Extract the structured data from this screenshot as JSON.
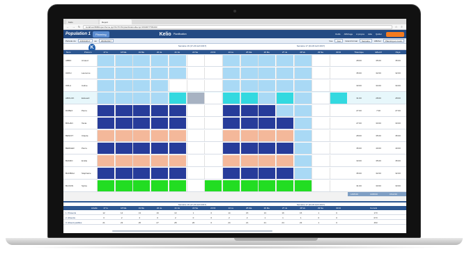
{
  "browser": {
    "tabs": [
      "Kelio",
      "Report"
    ],
    "url": "localhost:8080/open/home.jsp?ACTION=planification&temp=1503677781003"
  },
  "app": {
    "title": "Population 1",
    "planning_button": "Planning",
    "brand": "Kelio",
    "brand_sub": "Planification",
    "menu": [
      "Outils",
      "Affichage",
      "A propos",
      "Aide",
      "Quitter"
    ]
  },
  "toolbar": {
    "label": "Période du",
    "date_from": "23/04/2017",
    "to_label": "au",
    "date_to": "29/04/2017",
    "view_label": "Vue",
    "view_value": "Jour",
    "group_label": "Grand format",
    "group_value": "Semaine",
    "display_label": "Afficher",
    "display_value": "Planning en cours"
  },
  "grid": {
    "week1": "Semaine 16 (17-23 Avril 2017)",
    "week2": "Semaine 17 (24-30 Avril 2017)",
    "col_nom": "Nom",
    "col_prenom": "Prénom",
    "days": [
      "17 lu",
      "18 Ma",
      "19 Me",
      "20 Je",
      "21 Ve",
      "22 Sa",
      "23 Di",
      "24 Lu",
      "25 Ma",
      "26 Me",
      "27 Je",
      "28 Ve",
      "29 Sa",
      "30 Di"
    ],
    "stats_headers": [
      "Théorique",
      "Effectif",
      "Payé"
    ],
    "rows": [
      {
        "nom": "ABBO",
        "prenom": "Arnaud",
        "stats": [
          "28:00",
          "35:00",
          "35:00"
        ]
      },
      {
        "nom": "OZOU",
        "prenom": "Laurence",
        "stats": [
          "35:00",
          "32:00",
          "32:00"
        ]
      },
      {
        "nom": "ORLA",
        "prenom": "Céline",
        "stats": [
          "33:00",
          "34:00",
          "34:00"
        ]
      },
      {
        "nom": "ABOLOK",
        "prenom": "Edouard",
        "stats": [
          "31:00",
          "28:00",
          "28:00"
        ]
      },
      {
        "nom": "DUBEX",
        "prenom": "Pierre",
        "stats": [
          "27:00",
          "7:00",
          "27:00"
        ]
      },
      {
        "nom": "BOHAN",
        "prenom": "Tania",
        "stats": [
          "27:00",
          "33:00",
          "33:00"
        ]
      },
      {
        "nom": "BENOIT",
        "prenom": "Claude",
        "stats": [
          "28:00",
          "35:00",
          "35:00"
        ]
      },
      {
        "nom": "BERGER",
        "prenom": "Pierre",
        "stats": [
          "35:00",
          "40:00",
          "40:00"
        ]
      },
      {
        "nom": "BAKRO",
        "prenom": "Emilie",
        "stats": [
          "33:00",
          "35:00",
          "35:00"
        ]
      },
      {
        "nom": "BLINBALI",
        "prenom": "Stéphanie",
        "stats": [
          "35:00",
          "32:00",
          "32:00"
        ]
      },
      {
        "nom": "BLOUIN",
        "prenom": "Sylvie",
        "stats": [
          "31:00",
          "33:00",
          "33:00"
        ]
      }
    ],
    "totals": [
      "1495:00",
      "1368:00",
      "1512:00"
    ]
  },
  "bottom": {
    "week1": "Semaine 16 (17-23 Avril 2017)",
    "week2": "Semaine 17 (24-30 Avril 2017)",
    "header_label": "Libellé",
    "total_header": "Cumuls",
    "rows": [
      {
        "label": "Présents",
        "values": [
          "12",
          "14",
          "13",
          "16",
          "13",
          "1",
          "0",
          "14",
          "15",
          "13",
          "16",
          "15",
          "1",
          "0"
        ],
        "total": "173"
      },
      {
        "label": "Absents",
        "values": [
          "3",
          "2",
          "2",
          "0",
          "2",
          "0",
          "0",
          "2",
          "2",
          "1",
          "1",
          "1",
          "0",
          "0"
        ],
        "total": "073"
      },
      {
        "label": "Absent justifiés",
        "values": [
          "21",
          "23",
          "25",
          "27",
          "28",
          "20",
          "0",
          "24",
          "21",
          "21",
          "24",
          "23",
          "1",
          "0"
        ],
        "total": "463"
      }
    ]
  },
  "colors": {
    "header_blue": "#234a83",
    "light_blue": "#a9d9f5",
    "cyan": "#33d9e0",
    "green": "#22dd22",
    "dark_blue": "#273c9a",
    "peach": "#f4b89a",
    "gray": "#a7b2c2"
  }
}
